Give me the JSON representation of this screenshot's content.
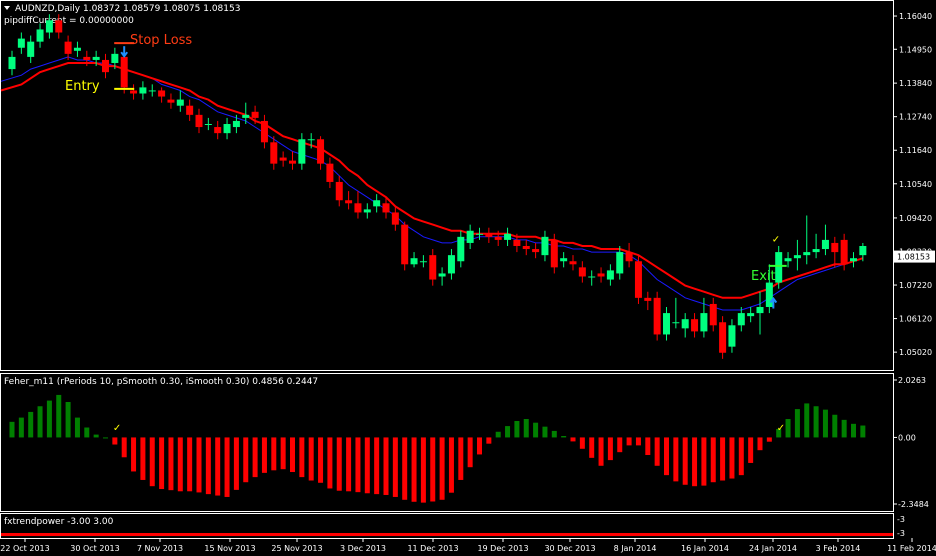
{
  "header": {
    "symbol_line": "AUDNZD,Daily  1.08372 1.08579 1.08075 1.08153",
    "indicator_line": "pipdiffCurrent = 0.00000000"
  },
  "annotations": {
    "stop_loss": "Stop Loss",
    "entry": "Entry",
    "exit": "Exit"
  },
  "panels": {
    "fisher_label": "Feher_m11   (rPeriods 10, pSmooth 0.30, iSmooth 0.30)   0.4856 0.2447",
    "trend_label": "fxtrendpower -3.00 3.00"
  },
  "colors": {
    "bull": "#00ff7f",
    "bear": "#ff0000",
    "slow_ma": "#ff0000",
    "fast_ma": "#1a1aff",
    "hist_pos": "#008000",
    "hist_neg": "#ff0000",
    "stop_loss": "#ff3c14",
    "entry": "#ffff00",
    "exit": "#32ff32"
  },
  "chart_data": [
    {
      "type": "candlestick",
      "title": "AUDNZD,Daily",
      "ylim": [
        1.045,
        1.165
      ],
      "y_ticks": [
        "1.16040",
        "1.14950",
        "1.13840",
        "1.12740",
        "1.11640",
        "1.10540",
        "1.09420",
        "1.08320",
        "1.07220",
        "1.06120",
        "1.05020"
      ],
      "current_price": "1.08153",
      "x_ticks": [
        "22 Oct 2013",
        "30 Oct 2013",
        "7 Nov 2013",
        "15 Nov 2013",
        "25 Nov 2013",
        "3 Dec 2013",
        "11 Dec 2013",
        "19 Dec 2013",
        "30 Dec 2013",
        "8 Jan 2014",
        "16 Jan 2014",
        "24 Jan 2014",
        "3 Feb 2014",
        "11 Feb 2014"
      ],
      "candles": [
        {
          "o": 1.143,
          "c": 1.147,
          "h": 1.149,
          "l": 1.141
        },
        {
          "o": 1.15,
          "c": 1.153,
          "h": 1.155,
          "l": 1.148
        },
        {
          "o": 1.147,
          "c": 1.152,
          "h": 1.154,
          "l": 1.145
        },
        {
          "o": 1.152,
          "c": 1.156,
          "h": 1.158,
          "l": 1.15
        },
        {
          "o": 1.155,
          "c": 1.159,
          "h": 1.161,
          "l": 1.153
        },
        {
          "o": 1.159,
          "c": 1.155,
          "h": 1.161,
          "l": 1.153
        },
        {
          "o": 1.152,
          "c": 1.148,
          "h": 1.154,
          "l": 1.146
        },
        {
          "o": 1.149,
          "c": 1.15,
          "h": 1.152,
          "l": 1.147
        },
        {
          "o": 1.147,
          "c": 1.146,
          "h": 1.149,
          "l": 1.144
        },
        {
          "o": 1.146,
          "c": 1.147,
          "h": 1.149,
          "l": 1.144
        },
        {
          "o": 1.146,
          "c": 1.142,
          "h": 1.148,
          "l": 1.14
        },
        {
          "o": 1.145,
          "c": 1.148,
          "h": 1.15,
          "l": 1.143
        },
        {
          "o": 1.147,
          "c": 1.137,
          "h": 1.149,
          "l": 1.135
        },
        {
          "o": 1.136,
          "c": 1.135,
          "h": 1.138,
          "l": 1.133
        },
        {
          "o": 1.135,
          "c": 1.137,
          "h": 1.139,
          "l": 1.133
        },
        {
          "o": 1.136,
          "c": 1.136,
          "h": 1.138,
          "l": 1.134
        },
        {
          "o": 1.136,
          "c": 1.134,
          "h": 1.137,
          "l": 1.132
        },
        {
          "o": 1.133,
          "c": 1.132,
          "h": 1.135,
          "l": 1.13
        },
        {
          "o": 1.131,
          "c": 1.133,
          "h": 1.136,
          "l": 1.129
        },
        {
          "o": 1.131,
          "c": 1.128,
          "h": 1.133,
          "l": 1.126
        },
        {
          "o": 1.128,
          "c": 1.124,
          "h": 1.13,
          "l": 1.122
        },
        {
          "o": 1.125,
          "c": 1.125,
          "h": 1.127,
          "l": 1.123
        },
        {
          "o": 1.124,
          "c": 1.122,
          "h": 1.126,
          "l": 1.12
        },
        {
          "o": 1.122,
          "c": 1.125,
          "h": 1.127,
          "l": 1.12
        },
        {
          "o": 1.124,
          "c": 1.126,
          "h": 1.128,
          "l": 1.122
        },
        {
          "o": 1.127,
          "c": 1.128,
          "h": 1.132,
          "l": 1.125
        },
        {
          "o": 1.129,
          "c": 1.127,
          "h": 1.131,
          "l": 1.125
        },
        {
          "o": 1.126,
          "c": 1.119,
          "h": 1.128,
          "l": 1.117
        },
        {
          "o": 1.119,
          "c": 1.112,
          "h": 1.121,
          "l": 1.11
        },
        {
          "o": 1.114,
          "c": 1.113,
          "h": 1.116,
          "l": 1.111
        },
        {
          "o": 1.113,
          "c": 1.112,
          "h": 1.116,
          "l": 1.11
        },
        {
          "o": 1.112,
          "c": 1.12,
          "h": 1.122,
          "l": 1.11
        },
        {
          "o": 1.12,
          "c": 1.12,
          "h": 1.122,
          "l": 1.117
        },
        {
          "o": 1.12,
          "c": 1.112,
          "h": 1.121,
          "l": 1.11
        },
        {
          "o": 1.112,
          "c": 1.106,
          "h": 1.114,
          "l": 1.104
        },
        {
          "o": 1.106,
          "c": 1.1,
          "h": 1.108,
          "l": 1.098
        },
        {
          "o": 1.1,
          "c": 1.099,
          "h": 1.103,
          "l": 1.097
        },
        {
          "o": 1.099,
          "c": 1.096,
          "h": 1.103,
          "l": 1.094
        },
        {
          "o": 1.096,
          "c": 1.097,
          "h": 1.099,
          "l": 1.094
        },
        {
          "o": 1.098,
          "c": 1.1,
          "h": 1.102,
          "l": 1.096
        },
        {
          "o": 1.099,
          "c": 1.096,
          "h": 1.101,
          "l": 1.094
        },
        {
          "o": 1.096,
          "c": 1.092,
          "h": 1.098,
          "l": 1.09
        },
        {
          "o": 1.092,
          "c": 1.079,
          "h": 1.093,
          "l": 1.077
        },
        {
          "o": 1.079,
          "c": 1.081,
          "h": 1.083,
          "l": 1.078
        },
        {
          "o": 1.08,
          "c": 1.08,
          "h": 1.082,
          "l": 1.078
        },
        {
          "o": 1.082,
          "c": 1.074,
          "h": 1.084,
          "l": 1.072
        },
        {
          "o": 1.075,
          "c": 1.076,
          "h": 1.078,
          "l": 1.072
        },
        {
          "o": 1.076,
          "c": 1.082,
          "h": 1.084,
          "l": 1.074
        },
        {
          "o": 1.08,
          "c": 1.088,
          "h": 1.09,
          "l": 1.078
        },
        {
          "o": 1.086,
          "c": 1.09,
          "h": 1.092,
          "l": 1.084
        },
        {
          "o": 1.089,
          "c": 1.089,
          "h": 1.091,
          "l": 1.087
        },
        {
          "o": 1.089,
          "c": 1.088,
          "h": 1.091,
          "l": 1.086
        },
        {
          "o": 1.088,
          "c": 1.087,
          "h": 1.09,
          "l": 1.085
        },
        {
          "o": 1.087,
          "c": 1.089,
          "h": 1.091,
          "l": 1.085
        },
        {
          "o": 1.087,
          "c": 1.085,
          "h": 1.089,
          "l": 1.083
        },
        {
          "o": 1.085,
          "c": 1.084,
          "h": 1.087,
          "l": 1.082
        },
        {
          "o": 1.084,
          "c": 1.083,
          "h": 1.086,
          "l": 1.081
        },
        {
          "o": 1.082,
          "c": 1.088,
          "h": 1.09,
          "l": 1.08
        },
        {
          "o": 1.087,
          "c": 1.078,
          "h": 1.089,
          "l": 1.076
        },
        {
          "o": 1.08,
          "c": 1.081,
          "h": 1.083,
          "l": 1.078
        },
        {
          "o": 1.08,
          "c": 1.079,
          "h": 1.082,
          "l": 1.077
        },
        {
          "o": 1.078,
          "c": 1.075,
          "h": 1.08,
          "l": 1.073
        },
        {
          "o": 1.075,
          "c": 1.075,
          "h": 1.077,
          "l": 1.072
        },
        {
          "o": 1.076,
          "c": 1.075,
          "h": 1.078,
          "l": 1.073
        },
        {
          "o": 1.074,
          "c": 1.077,
          "h": 1.079,
          "l": 1.072
        },
        {
          "o": 1.076,
          "c": 1.083,
          "h": 1.085,
          "l": 1.074
        },
        {
          "o": 1.083,
          "c": 1.08,
          "h": 1.086,
          "l": 1.078
        },
        {
          "o": 1.08,
          "c": 1.068,
          "h": 1.082,
          "l": 1.066
        },
        {
          "o": 1.068,
          "c": 1.067,
          "h": 1.07,
          "l": 1.064
        },
        {
          "o": 1.068,
          "c": 1.056,
          "h": 1.07,
          "l": 1.054
        },
        {
          "o": 1.056,
          "c": 1.063,
          "h": 1.065,
          "l": 1.054
        },
        {
          "o": 1.06,
          "c": 1.06,
          "h": 1.068,
          "l": 1.058
        },
        {
          "o": 1.058,
          "c": 1.061,
          "h": 1.063,
          "l": 1.055
        },
        {
          "o": 1.061,
          "c": 1.057,
          "h": 1.063,
          "l": 1.055
        },
        {
          "o": 1.057,
          "c": 1.063,
          "h": 1.068,
          "l": 1.055
        },
        {
          "o": 1.066,
          "c": 1.059,
          "h": 1.068,
          "l": 1.057
        },
        {
          "o": 1.06,
          "c": 1.05,
          "h": 1.062,
          "l": 1.048
        },
        {
          "o": 1.052,
          "c": 1.059,
          "h": 1.061,
          "l": 1.05
        },
        {
          "o": 1.059,
          "c": 1.063,
          "h": 1.065,
          "l": 1.057
        },
        {
          "o": 1.062,
          "c": 1.063,
          "h": 1.065,
          "l": 1.06
        },
        {
          "o": 1.063,
          "c": 1.065,
          "h": 1.07,
          "l": 1.056
        },
        {
          "o": 1.065,
          "c": 1.073,
          "h": 1.079,
          "l": 1.063
        },
        {
          "o": 1.073,
          "c": 1.083,
          "h": 1.085,
          "l": 1.071
        },
        {
          "o": 1.08,
          "c": 1.081,
          "h": 1.083,
          "l": 1.078
        },
        {
          "o": 1.081,
          "c": 1.082,
          "h": 1.087,
          "l": 1.077
        },
        {
          "o": 1.082,
          "c": 1.083,
          "h": 1.095,
          "l": 1.079
        },
        {
          "o": 1.083,
          "c": 1.084,
          "h": 1.089,
          "l": 1.081
        },
        {
          "o": 1.084,
          "c": 1.087,
          "h": 1.092,
          "l": 1.082
        },
        {
          "o": 1.086,
          "c": 1.083,
          "h": 1.088,
          "l": 1.078
        },
        {
          "o": 1.087,
          "c": 1.079,
          "h": 1.089,
          "l": 1.077
        },
        {
          "o": 1.08,
          "c": 1.081,
          "h": 1.083,
          "l": 1.078
        },
        {
          "o": 1.082,
          "c": 1.085,
          "h": 1.086,
          "l": 1.08
        }
      ],
      "slow_ma": [
        1.136,
        1.138,
        1.14,
        1.142,
        1.143,
        1.144,
        1.145,
        1.145,
        1.145,
        1.145,
        1.144,
        1.144,
        1.143,
        1.142,
        1.141,
        1.14,
        1.139,
        1.138,
        1.137,
        1.136,
        1.134,
        1.133,
        1.131,
        1.13,
        1.129,
        1.128,
        1.126,
        1.125,
        1.123,
        1.121,
        1.12,
        1.119,
        1.118,
        1.117,
        1.115,
        1.113,
        1.11,
        1.108,
        1.105,
        1.103,
        1.101,
        1.098,
        1.096,
        1.094,
        1.093,
        1.092,
        1.091,
        1.09,
        1.09,
        1.089,
        1.089,
        1.089,
        1.089,
        1.089,
        1.088,
        1.088,
        1.088,
        1.087,
        1.087,
        1.086,
        1.086,
        1.085,
        1.085,
        1.084,
        1.084,
        1.084,
        1.083,
        1.082,
        1.08,
        1.078,
        1.076,
        1.074,
        1.072,
        1.071,
        1.07,
        1.069,
        1.068,
        1.068,
        1.068,
        1.069,
        1.07,
        1.071,
        1.073,
        1.074,
        1.075,
        1.076,
        1.077,
        1.078,
        1.079,
        1.079,
        1.08,
        1.081
      ],
      "fast_ma": [
        1.139,
        1.141,
        1.143,
        1.144,
        1.145,
        1.146,
        1.147,
        1.146,
        1.146,
        1.145,
        1.145,
        1.144,
        1.143,
        1.142,
        1.141,
        1.14,
        1.138,
        1.137,
        1.136,
        1.134,
        1.133,
        1.131,
        1.129,
        1.128,
        1.127,
        1.126,
        1.124,
        1.122,
        1.12,
        1.118,
        1.116,
        1.115,
        1.114,
        1.113,
        1.111,
        1.108,
        1.105,
        1.103,
        1.101,
        1.099,
        1.097,
        1.095,
        1.092,
        1.09,
        1.088,
        1.087,
        1.086,
        1.086,
        1.087,
        1.087,
        1.088,
        1.088,
        1.088,
        1.088,
        1.087,
        1.087,
        1.086,
        1.086,
        1.085,
        1.085,
        1.084,
        1.084,
        1.083,
        1.083,
        1.083,
        1.083,
        1.082,
        1.08,
        1.077,
        1.074,
        1.072,
        1.07,
        1.068,
        1.067,
        1.066,
        1.065,
        1.064,
        1.064,
        1.064,
        1.065,
        1.066,
        1.068,
        1.07,
        1.072,
        1.074,
        1.075,
        1.076,
        1.077,
        1.078,
        1.079,
        1.08,
        1.081
      ],
      "markers": {
        "sell_arrow_index": 12,
        "stop_loss_level": 1.1515,
        "entry_level": 1.1365,
        "exit_index": 82,
        "exit_level": 1.0785,
        "buy_arrow_index": 81
      }
    },
    {
      "type": "bar",
      "title": "Feher_m11",
      "ylim": [
        -2.3484,
        2.0263
      ],
      "y_ticks": [
        "2.0263",
        "0.00",
        "-2.3484"
      ],
      "values": [
        0.55,
        0.7,
        0.9,
        1.1,
        1.3,
        1.5,
        1.25,
        0.7,
        0.35,
        0.1,
        0.0,
        -0.25,
        -0.7,
        -1.2,
        -1.5,
        -1.72,
        -1.82,
        -1.86,
        -1.9,
        -1.9,
        -1.94,
        -2.0,
        -2.05,
        -2.1,
        -1.85,
        -1.58,
        -1.4,
        -1.25,
        -1.16,
        -1.12,
        -1.22,
        -1.4,
        -1.52,
        -1.6,
        -1.8,
        -1.88,
        -1.9,
        -1.93,
        -1.97,
        -2.0,
        -2.03,
        -2.1,
        -2.2,
        -2.27,
        -2.3,
        -2.26,
        -2.2,
        -1.95,
        -1.5,
        -1.05,
        -0.6,
        -0.22,
        0.2,
        0.4,
        0.58,
        0.65,
        0.52,
        0.38,
        0.23,
        0.05,
        -0.14,
        -0.4,
        -0.72,
        -1.0,
        -0.8,
        -0.52,
        -0.28,
        -0.28,
        -0.62,
        -1.0,
        -1.33,
        -1.55,
        -1.67,
        -1.72,
        -1.7,
        -1.58,
        -1.52,
        -1.45,
        -1.33,
        -0.9,
        -0.45,
        -0.15,
        0.3,
        0.65,
        1.0,
        1.2,
        1.1,
        0.98,
        0.8,
        0.62,
        0.48,
        0.42
      ],
      "check_indices": [
        11,
        82
      ]
    }
  ]
}
